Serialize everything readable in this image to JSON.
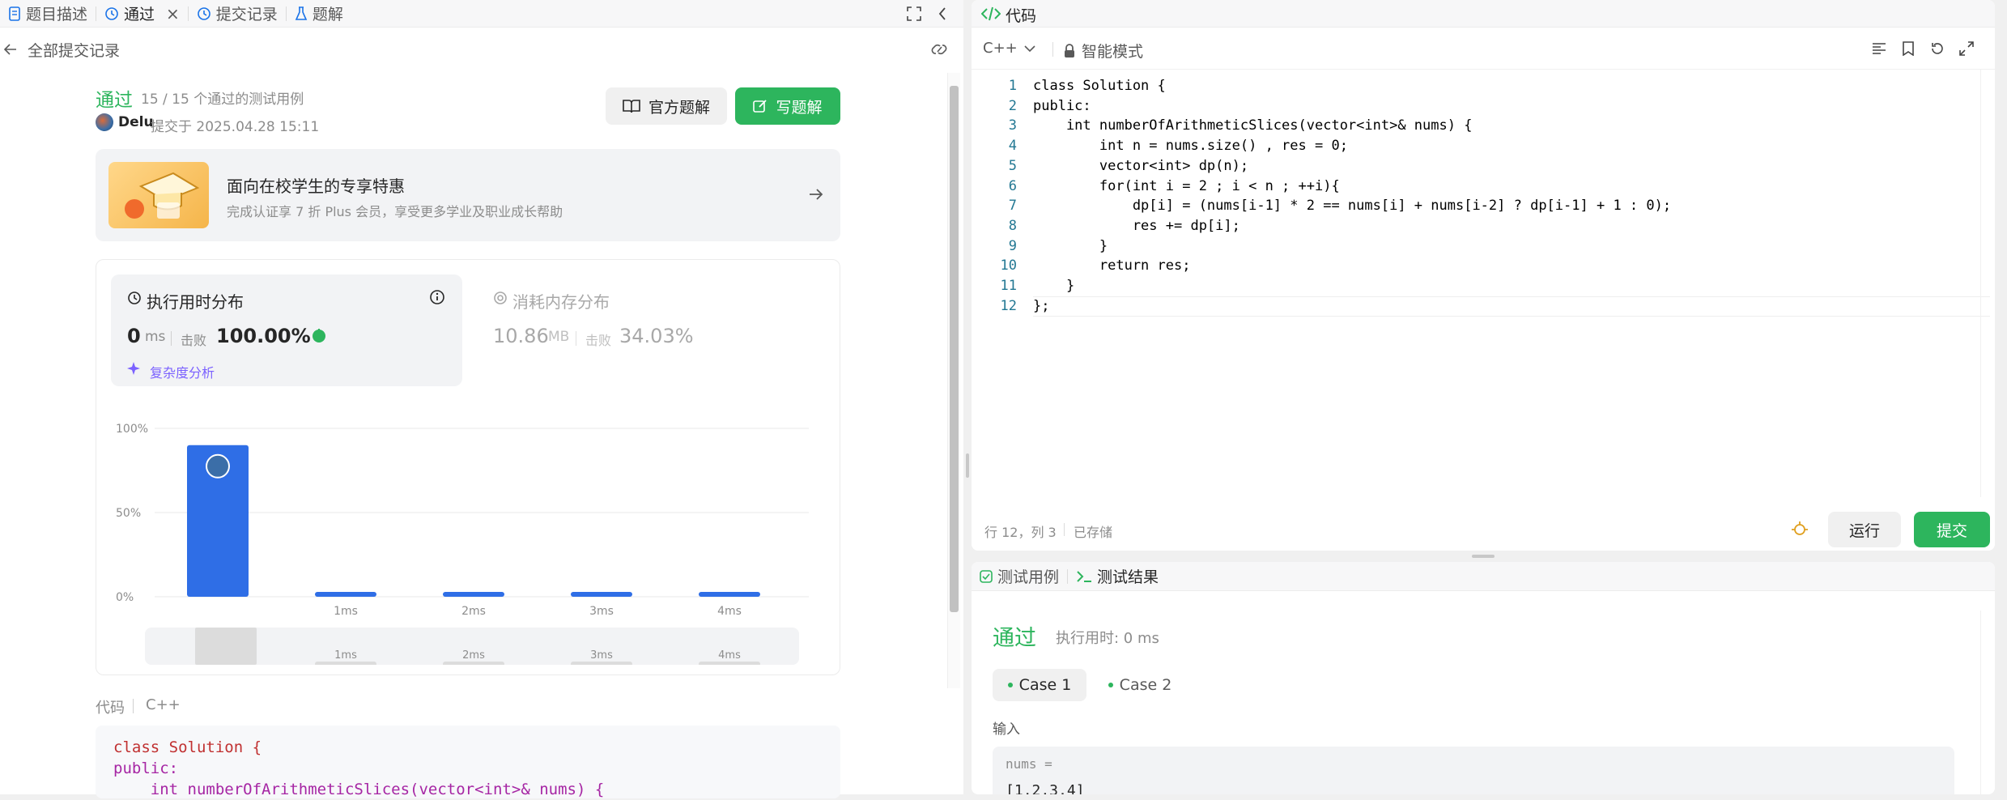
{
  "left_tabs": [
    {
      "label": "题目描述",
      "icon": "description-icon"
    },
    {
      "label": "通过",
      "icon": "history-icon"
    },
    {
      "label": "提交记录",
      "icon": "history-icon"
    },
    {
      "label": "题解",
      "icon": "flask-icon"
    }
  ],
  "back_label": "全部提交记录",
  "result": {
    "status": "通过",
    "tests": "15 / 15 个通过的测试用例",
    "user": "Delu",
    "submitted": "提交于 2025.04.28 15:11"
  },
  "buttons": {
    "official": "官方题解",
    "write": "写题解",
    "run": "运行",
    "submit": "提交"
  },
  "promo": {
    "title": "面向在校学生的专享特惠",
    "desc": "完成认证享 7 折 Plus 会员，享受更多学业及职业成长帮助"
  },
  "runtime": {
    "title": "执行用时分布",
    "value": "0",
    "unit": "ms",
    "beat_label": "击败",
    "beat": "100.00%",
    "analysis": "复杂度分析"
  },
  "memory": {
    "title": "消耗内存分布",
    "value": "10.86",
    "unit": "MB",
    "beat_label": "击败",
    "beat": "34.03%"
  },
  "chart_data": {
    "type": "bar",
    "categories": [
      "",
      "1ms",
      "2ms",
      "3ms",
      "4ms"
    ],
    "values": [
      90,
      2,
      2,
      2,
      2
    ],
    "ylim": [
      0,
      100
    ],
    "yticks": [
      "100%",
      "50%",
      "0%"
    ],
    "grid": true
  },
  "code_section": {
    "label": "代码",
    "lang": "C++",
    "preview": [
      "class Solution {",
      "public:",
      "    int numberOfArithmeticSlices(vector<int>& nums) {"
    ]
  },
  "editor": {
    "title": "代码",
    "lang": "C++",
    "mode": "智能模式",
    "status_pos": "行 12，列 3",
    "status_saved": "已存储"
  },
  "code_lines": [
    "class Solution {",
    "public:",
    "    int numberOfArithmeticSlices(vector<int>& nums) {",
    "        int n = nums.size() , res = 0;",
    "        vector<int> dp(n);",
    "        for(int i = 2 ; i < n ; ++i){",
    "            dp[i] = (nums[i-1] * 2 == nums[i] + nums[i-2] ? dp[i-1] + 1 : 0);",
    "            res += dp[i];",
    "        }",
    "        return res;",
    "    }",
    "};"
  ],
  "line_numbers": [
    "1",
    "2",
    "3",
    "4",
    "5",
    "6",
    "7",
    "8",
    "9",
    "10",
    "11",
    "12"
  ],
  "test_tabs": {
    "cases": "测试用例",
    "results": "测试结果"
  },
  "test_result": {
    "status": "通过",
    "runtime": "执行用时: 0 ms",
    "case1": "Case 1",
    "case2": "Case 2",
    "input_label": "输入",
    "var": "nums =",
    "value": "[1,2,3,4]"
  },
  "colors": {
    "green": "#2db55d",
    "blue": "#2f6ee6",
    "accent": "#007aff"
  }
}
